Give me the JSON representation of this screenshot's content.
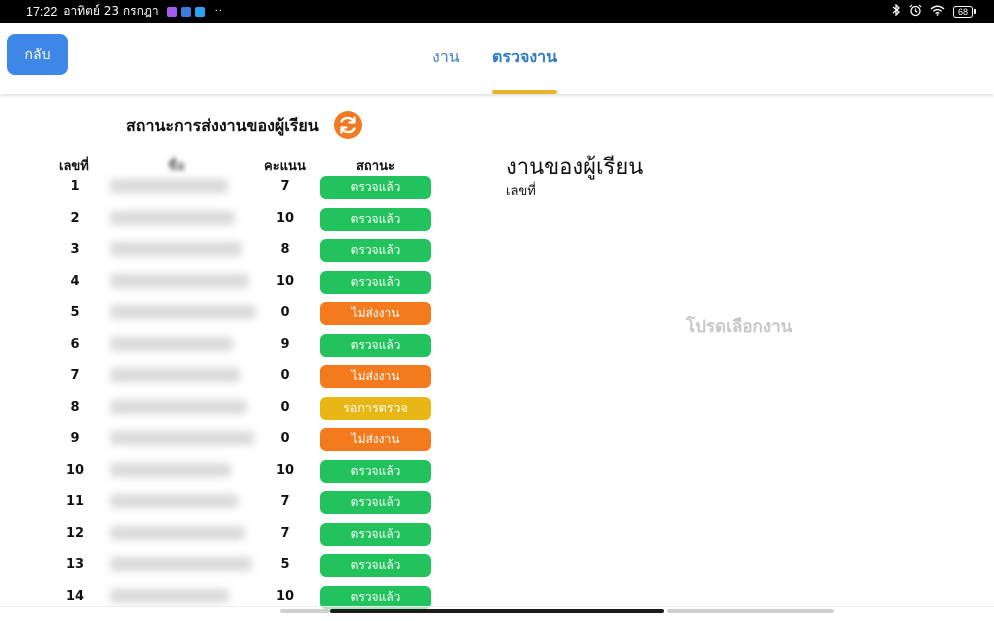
{
  "status_bar": {
    "time": "17:22",
    "date": "อาทิตย์ 23 กรกฎา",
    "overflow": "··",
    "battery": "68",
    "icons": [
      "bluetooth-icon",
      "alarm-icon",
      "wifi-icon",
      "battery-icon"
    ]
  },
  "header": {
    "back_label": "กลับ",
    "tabs": [
      {
        "label": "งาน",
        "active": false
      },
      {
        "label": "ตรวจงาน",
        "active": true
      }
    ]
  },
  "left_panel": {
    "title": "สถานะการส่งงานของผู้เรียน",
    "columns": {
      "no": "เลขที่",
      "name": "ชื่อ",
      "score": "คะแนน",
      "status": "สถานะ"
    },
    "rows": [
      {
        "no": "1",
        "score": "7",
        "status": "ตรวจแล้ว",
        "kind": "done"
      },
      {
        "no": "2",
        "score": "10",
        "status": "ตรวจแล้ว",
        "kind": "done"
      },
      {
        "no": "3",
        "score": "8",
        "status": "ตรวจแล้ว",
        "kind": "done"
      },
      {
        "no": "4",
        "score": "10",
        "status": "ตรวจแล้ว",
        "kind": "done"
      },
      {
        "no": "5",
        "score": "0",
        "status": "ไม่ส่งงาน",
        "kind": "missing"
      },
      {
        "no": "6",
        "score": "9",
        "status": "ตรวจแล้ว",
        "kind": "done"
      },
      {
        "no": "7",
        "score": "0",
        "status": "ไม่ส่งงาน",
        "kind": "missing"
      },
      {
        "no": "8",
        "score": "0",
        "status": "รอการตรวจ",
        "kind": "waiting"
      },
      {
        "no": "9",
        "score": "0",
        "status": "ไม่ส่งงาน",
        "kind": "missing"
      },
      {
        "no": "10",
        "score": "10",
        "status": "ตรวจแล้ว",
        "kind": "done"
      },
      {
        "no": "11",
        "score": "7",
        "status": "ตรวจแล้ว",
        "kind": "done"
      },
      {
        "no": "12",
        "score": "7",
        "status": "ตรวจแล้ว",
        "kind": "done"
      },
      {
        "no": "13",
        "score": "5",
        "status": "ตรวจแล้ว",
        "kind": "done"
      },
      {
        "no": "14",
        "score": "10",
        "status": "ตรวจแล้ว",
        "kind": "done"
      }
    ]
  },
  "right_panel": {
    "title": "งานของผู้เรียน",
    "subtitle": "เลขที่",
    "placeholder": "โปรดเลือกงาน"
  },
  "colors": {
    "accent": "#3f87e6",
    "tab_underline": "#e8b52a",
    "done": "#22c35c",
    "missing": "#f47a1e",
    "waiting": "#e8b716",
    "refresh": "#f07b22"
  }
}
